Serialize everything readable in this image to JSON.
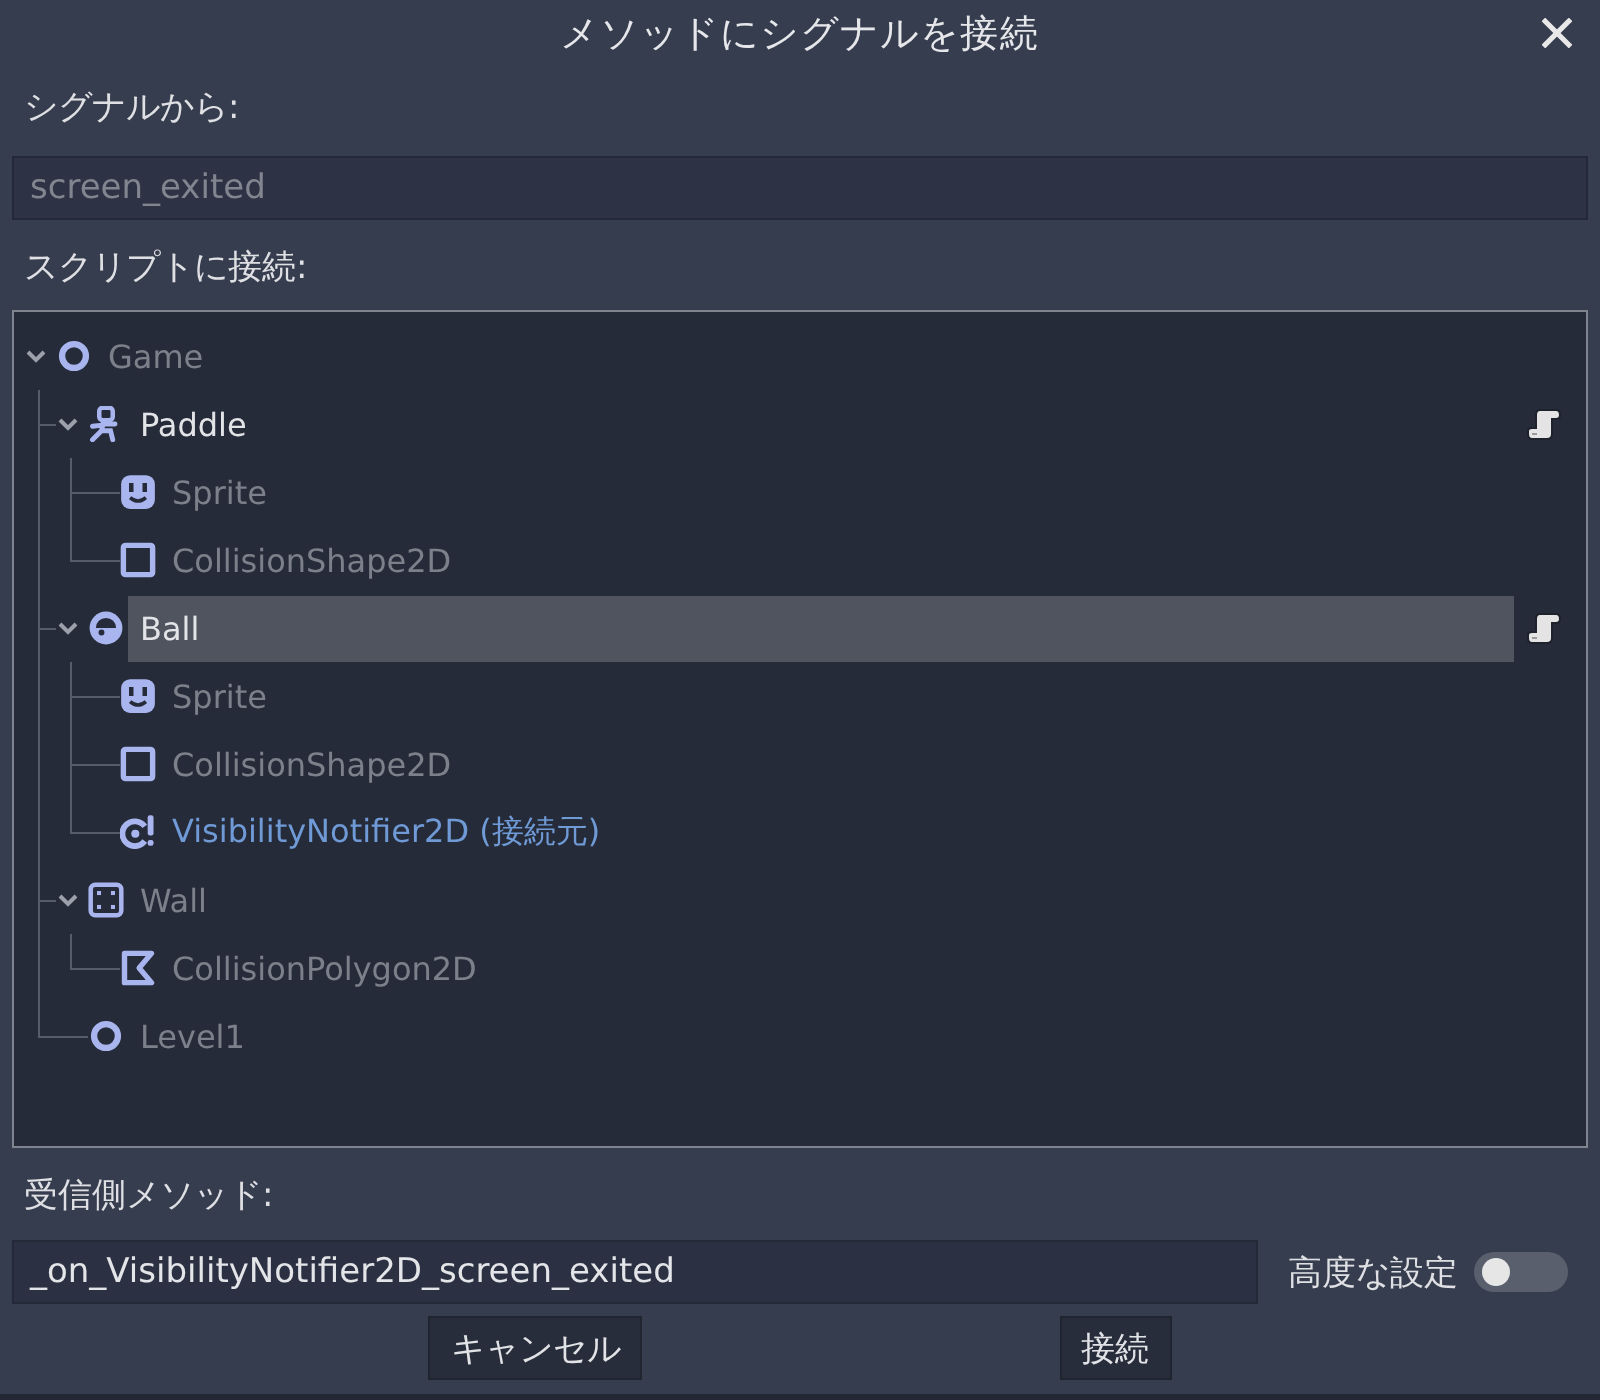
{
  "window": {
    "title": "メソッドにシグナルを接続"
  },
  "signal": {
    "label": "シグナルから:",
    "field": {
      "value": "screen_exited",
      "disabled": true
    }
  },
  "script_tree": {
    "label": "スクリプトに接続:",
    "nodes": [
      {
        "name": "Game",
        "kind": "node",
        "expanded": true,
        "selected": false,
        "disabled": true,
        "source": false,
        "script": false,
        "children": [
          {
            "name": "Paddle",
            "kind": "kinematic-body",
            "expanded": true,
            "selected": false,
            "disabled": false,
            "source": false,
            "script": true,
            "children": [
              {
                "name": "Sprite",
                "kind": "sprite",
                "selected": false,
                "disabled": true,
                "source": false,
                "script": false
              },
              {
                "name": "CollisionShape2D",
                "kind": "collision-shape",
                "selected": false,
                "disabled": true,
                "source": false,
                "script": false
              }
            ]
          },
          {
            "name": "Ball",
            "kind": "rigid-body",
            "expanded": true,
            "selected": true,
            "disabled": false,
            "source": false,
            "script": true,
            "children": [
              {
                "name": "Sprite",
                "kind": "sprite",
                "selected": false,
                "disabled": true,
                "source": false,
                "script": false
              },
              {
                "name": "CollisionShape2D",
                "kind": "collision-shape",
                "selected": false,
                "disabled": true,
                "source": false,
                "script": false
              },
              {
                "name": "VisibilityNotifier2D (接続元)",
                "kind": "visibility-notifier",
                "selected": false,
                "disabled": true,
                "source": true,
                "script": false
              }
            ]
          },
          {
            "name": "Wall",
            "kind": "static-body",
            "expanded": true,
            "selected": false,
            "disabled": true,
            "source": false,
            "script": false,
            "children": [
              {
                "name": "CollisionPolygon2D",
                "kind": "collision-polygon",
                "selected": false,
                "disabled": true,
                "source": false,
                "script": false
              }
            ]
          },
          {
            "name": "Level1",
            "kind": "node",
            "selected": false,
            "disabled": true,
            "source": false,
            "script": false
          }
        ]
      }
    ]
  },
  "method": {
    "label": "受信側メソッド:",
    "field": {
      "value": "_on_VisibilityNotifier2D_screen_exited",
      "disabled": false
    }
  },
  "advanced": {
    "label": "高度な設定",
    "on": false
  },
  "buttons": [
    {
      "label": "キャンセル"
    },
    {
      "label": "接続"
    }
  ]
}
